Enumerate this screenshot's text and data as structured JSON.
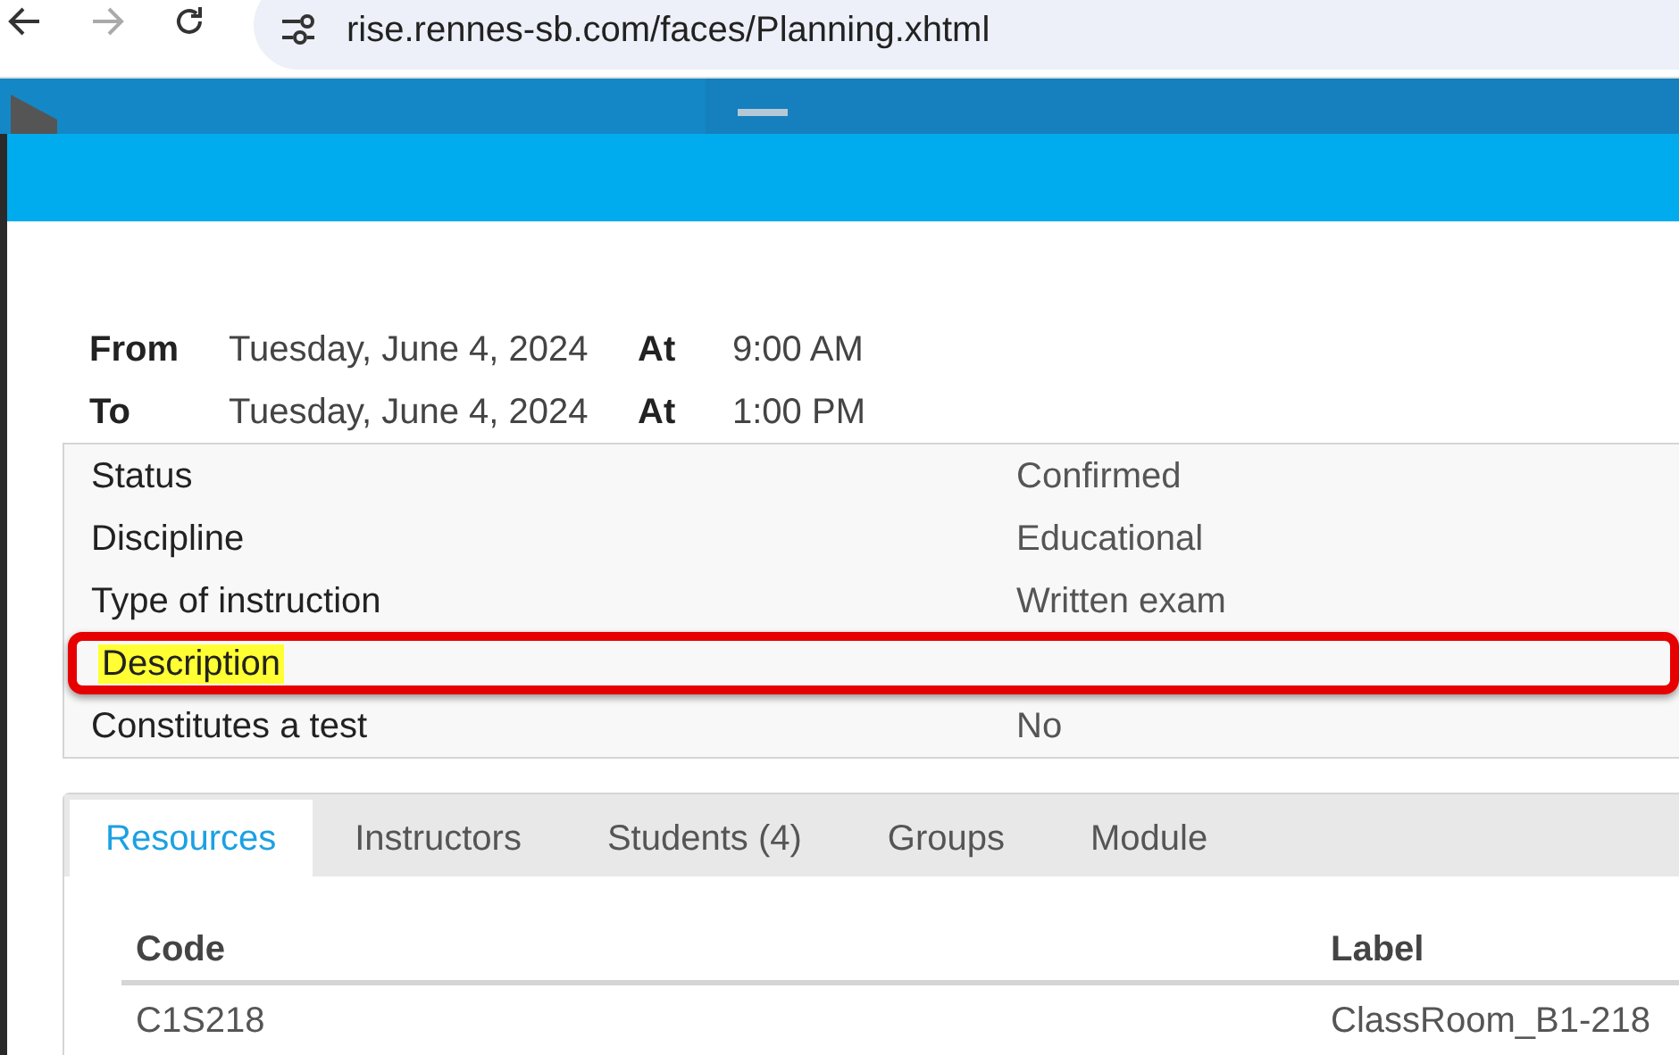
{
  "browser": {
    "url": "rise.rennes-sb.com/faces/Planning.xhtml"
  },
  "schedule": [
    {
      "label": "From",
      "date": "Tuesday, June 4, 2024",
      "at": "At",
      "time": "9:00 AM"
    },
    {
      "label": "To",
      "date": "Tuesday, June 4, 2024",
      "at": "At",
      "time": "1:00 PM"
    }
  ],
  "details": [
    {
      "label": "Status",
      "value": "Confirmed",
      "highlighted": false
    },
    {
      "label": "Discipline",
      "value": "Educational",
      "highlighted": false
    },
    {
      "label": "Type of instruction",
      "value": "Written exam",
      "highlighted": false
    },
    {
      "label": "Description",
      "highlighted": true
    },
    {
      "label": "Constitutes a test",
      "value": "No",
      "highlighted": false
    }
  ],
  "tabs": [
    {
      "label": "Resources",
      "selected": true
    },
    {
      "label": "Instructors",
      "selected": false
    },
    {
      "label": "Students (4)",
      "selected": false
    },
    {
      "label": "Groups",
      "selected": false
    },
    {
      "label": "Module",
      "selected": false
    }
  ],
  "table": {
    "columns": [
      "Code",
      "Label"
    ],
    "rows": [
      [
        "C1S218",
        "ClassRoom_B1-218"
      ]
    ]
  }
}
